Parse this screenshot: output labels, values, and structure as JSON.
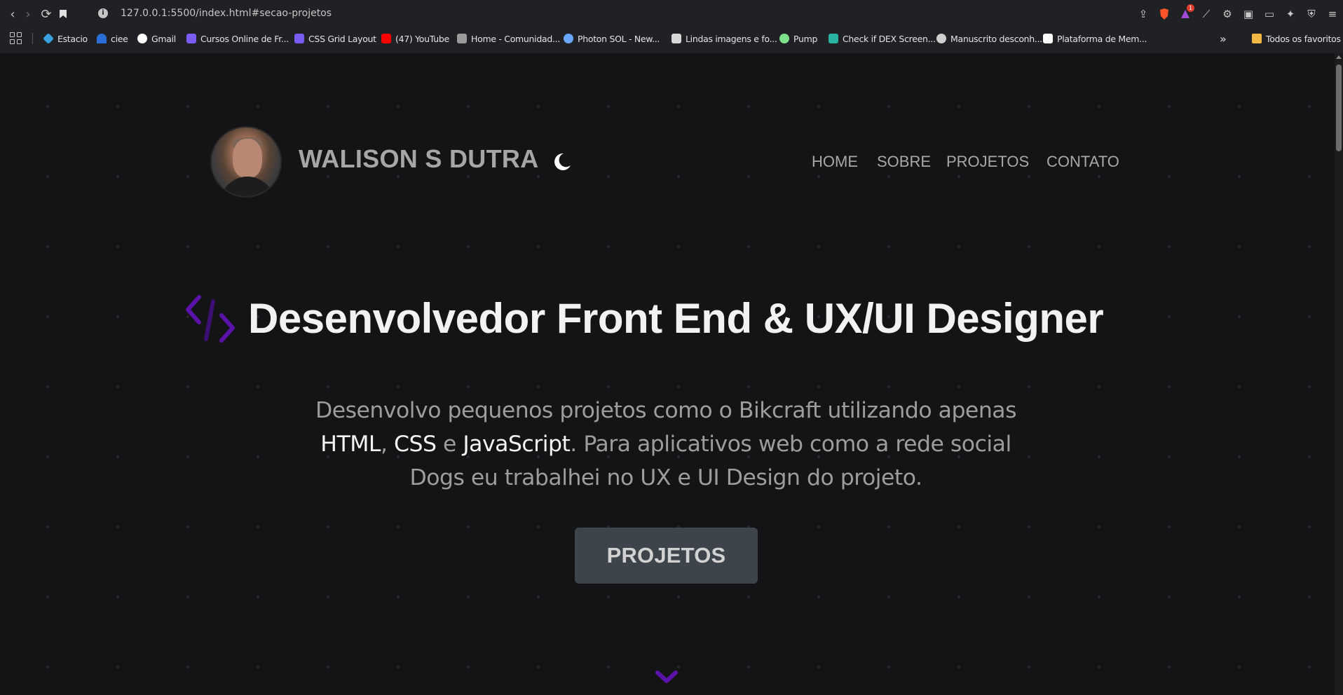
{
  "browser": {
    "url": "127.0.0.1:5500/index.html#secao-projetos",
    "bookmarks": [
      {
        "label": "Estacio",
        "color": "#3aa0e0"
      },
      {
        "label": "ciee",
        "color": "#2b6fd6"
      },
      {
        "label": "Gmail",
        "color": "#ffffff"
      },
      {
        "label": "Cursos Online de Fr...",
        "color": "#7b5cf0"
      },
      {
        "label": "CSS Grid Layout",
        "color": "#7b5cf0"
      },
      {
        "label": "(47) YouTube",
        "color": "#ff0000"
      },
      {
        "label": "Home - Comunidad...",
        "color": "#9a9a9a"
      },
      {
        "label": "Photon SOL - New...",
        "color": "#6aa8ff"
      },
      {
        "label": "Lindas imagens e fo...",
        "color": "#1a1a1a"
      },
      {
        "label": "Pump",
        "color": "#7ee08a"
      },
      {
        "label": "Check if DEX Screen...",
        "color": "#111111"
      },
      {
        "label": "Manuscrito desconh...",
        "color": "#cfcfcf"
      },
      {
        "label": "Plataforma de Mem...",
        "color": "#ffffff"
      }
    ],
    "bookmarks_overflow": "»",
    "favorites_folder": "Todos os favoritos",
    "notification_count": "1"
  },
  "site": {
    "brand": "WALISON S DUTRA",
    "nav": [
      "HOME",
      "SOBRE",
      "PROJETOS",
      "CONTATO"
    ],
    "hero": {
      "title": "Desenvolvedor Front End & UX/UI Designer",
      "text_1": "Desenvolvo pequenos projetos como o Bikcraft utilizando apenas ",
      "html": "HTML",
      "sep": ", ",
      "css": "CSS",
      "and": " e ",
      "js": "JavaScript",
      "text_2": ". Para aplicativos web como a rede social Dogs eu trabalhei no UX e UI Design do projeto.",
      "button": "PROJETOS"
    },
    "accent": "#5a12a8"
  }
}
